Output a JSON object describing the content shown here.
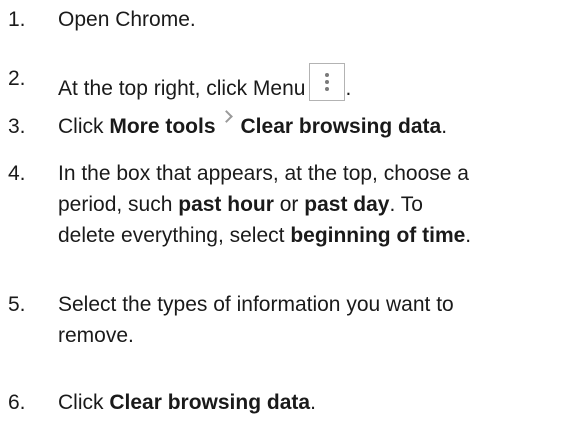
{
  "steps": [
    {
      "number": "1.",
      "text": "Open Chrome."
    },
    {
      "number": "2.",
      "text_before": "At the top right, click Menu",
      "text_after": "."
    },
    {
      "number": "3.",
      "prefix": "Click ",
      "bold1": "More tools",
      "bold2": "Clear browsing data",
      "suffix": "."
    },
    {
      "number": "4.",
      "line1": "In the box that appears, at the top, choose a",
      "line2_a": "period, such ",
      "line2_b1": "past hour",
      "line2_c": " or ",
      "line2_b2": "past day",
      "line2_d": ". To",
      "line3_a": "delete everything, select ",
      "line3_b": "beginning of time",
      "line3_c": "."
    },
    {
      "number": "5.",
      "line1": "Select the types of information you want to",
      "line2": "remove."
    },
    {
      "number": "6.",
      "prefix": "Click ",
      "bold": "Clear browsing data",
      "suffix": "."
    }
  ],
  "icons": {
    "menu": "three-dot-vertical-menu-icon",
    "chevron": "chevron-right-icon"
  },
  "colors": {
    "text": "#1a1a1a",
    "icon_border": "#b3b3b3",
    "icon_dots": "#7a7a7a",
    "chevron": "#9a9a9a"
  }
}
